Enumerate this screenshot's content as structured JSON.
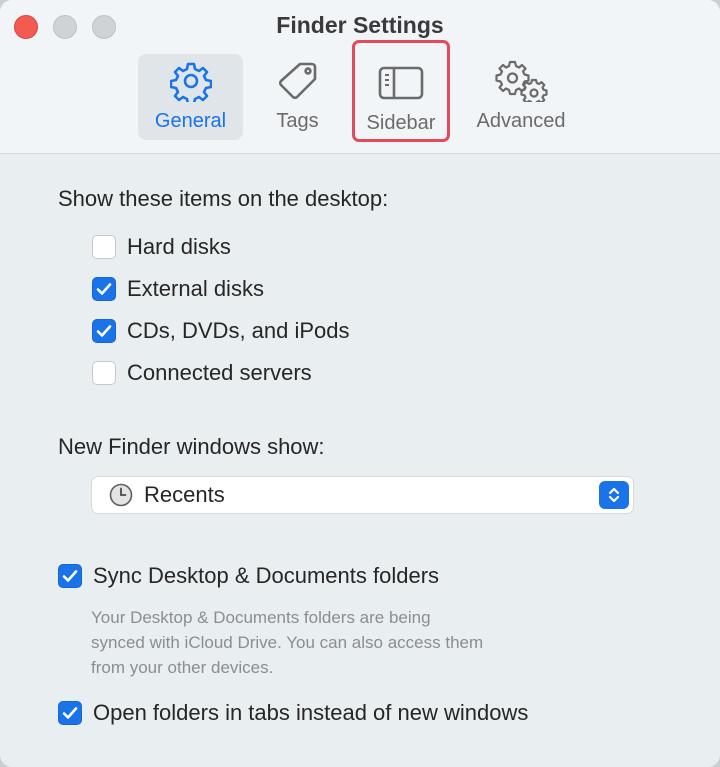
{
  "window": {
    "title": "Finder Settings"
  },
  "tabs": [
    {
      "label": "General",
      "icon": "gear-icon",
      "selected": true
    },
    {
      "label": "Tags",
      "icon": "tag-icon",
      "selected": false
    },
    {
      "label": "Sidebar",
      "icon": "sidebar-icon",
      "selected": false,
      "highlighted": true
    },
    {
      "label": "Advanced",
      "icon": "gears-icon",
      "selected": false
    }
  ],
  "desktop": {
    "label": "Show these items on the desktop:",
    "items": [
      {
        "label": "Hard disks",
        "checked": false
      },
      {
        "label": "External disks",
        "checked": true
      },
      {
        "label": "CDs, DVDs, and iPods",
        "checked": true
      },
      {
        "label": "Connected servers",
        "checked": false
      }
    ]
  },
  "new_window": {
    "label": "New Finder windows show:",
    "selected": "Recents",
    "icon": "clock-icon"
  },
  "sync": {
    "label": "Sync Desktop & Documents folders",
    "checked": true,
    "note_lines": [
      "Your Desktop & Documents folders are being",
      "synced with iCloud Drive. You can also access them",
      "from your other devices."
    ]
  },
  "tabs_option": {
    "label": "Open folders in tabs instead of new windows",
    "checked": true
  },
  "colors": {
    "accent": "#1a73e8",
    "highlight": "#e54a5b",
    "close": "#f25a52"
  }
}
